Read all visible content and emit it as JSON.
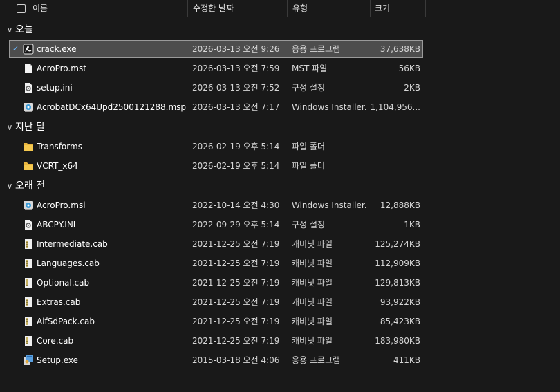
{
  "header": {
    "name": "이름",
    "date": "수정한 날짜",
    "type": "유형",
    "size": "크기"
  },
  "groups": [
    {
      "title": "오늘",
      "files": [
        {
          "name": "crack.exe",
          "date": "2026-03-13 오전 9:26",
          "type": "응용 프로그램",
          "size": "37,638KB",
          "icon": "acrobat-icon",
          "selected": true
        },
        {
          "name": "AcroPro.mst",
          "date": "2026-03-13 오전 7:59",
          "type": "MST 파일",
          "size": "56KB",
          "icon": "document-icon"
        },
        {
          "name": "setup.ini",
          "date": "2026-03-13 오전 7:52",
          "type": "구성 설정",
          "size": "2KB",
          "icon": "settings-file-icon"
        },
        {
          "name": "AcrobatDCx64Upd2500121288.msp",
          "date": "2026-03-13 오전 7:17",
          "type": "Windows Installer...",
          "size": "1,104,956...",
          "icon": "installer-icon"
        }
      ]
    },
    {
      "title": "지난 달",
      "files": [
        {
          "name": "Transforms",
          "date": "2026-02-19 오후 5:14",
          "type": "파일 폴더",
          "size": "",
          "icon": "folder-icon"
        },
        {
          "name": "VCRT_x64",
          "date": "2026-02-19 오후 5:14",
          "type": "파일 폴더",
          "size": "",
          "icon": "folder-icon"
        }
      ]
    },
    {
      "title": "오래 전",
      "files": [
        {
          "name": "AcroPro.msi",
          "date": "2022-10-14 오전 4:30",
          "type": "Windows Installer...",
          "size": "12,888KB",
          "icon": "installer-icon"
        },
        {
          "name": "ABCPY.INI",
          "date": "2022-09-29 오후 5:14",
          "type": "구성 설정",
          "size": "1KB",
          "icon": "settings-file-icon"
        },
        {
          "name": "Intermediate.cab",
          "date": "2021-12-25 오전 7:19",
          "type": "캐비닛 파일",
          "size": "125,274KB",
          "icon": "cabinet-icon"
        },
        {
          "name": "Languages.cab",
          "date": "2021-12-25 오전 7:19",
          "type": "캐비닛 파일",
          "size": "112,909KB",
          "icon": "cabinet-icon"
        },
        {
          "name": "Optional.cab",
          "date": "2021-12-25 오전 7:19",
          "type": "캐비닛 파일",
          "size": "129,813KB",
          "icon": "cabinet-icon"
        },
        {
          "name": "Extras.cab",
          "date": "2021-12-25 오전 7:19",
          "type": "캐비닛 파일",
          "size": "93,922KB",
          "icon": "cabinet-icon"
        },
        {
          "name": "AlfSdPack.cab",
          "date": "2021-12-25 오전 7:19",
          "type": "캐비닛 파일",
          "size": "85,423KB",
          "icon": "cabinet-icon"
        },
        {
          "name": "Core.cab",
          "date": "2021-12-25 오전 7:19",
          "type": "캐비닛 파일",
          "size": "183,980KB",
          "icon": "cabinet-icon"
        },
        {
          "name": "Setup.exe",
          "date": "2015-03-18 오전 4:06",
          "type": "응용 프로그램",
          "size": "411KB",
          "icon": "setup-exe-icon"
        }
      ]
    }
  ]
}
